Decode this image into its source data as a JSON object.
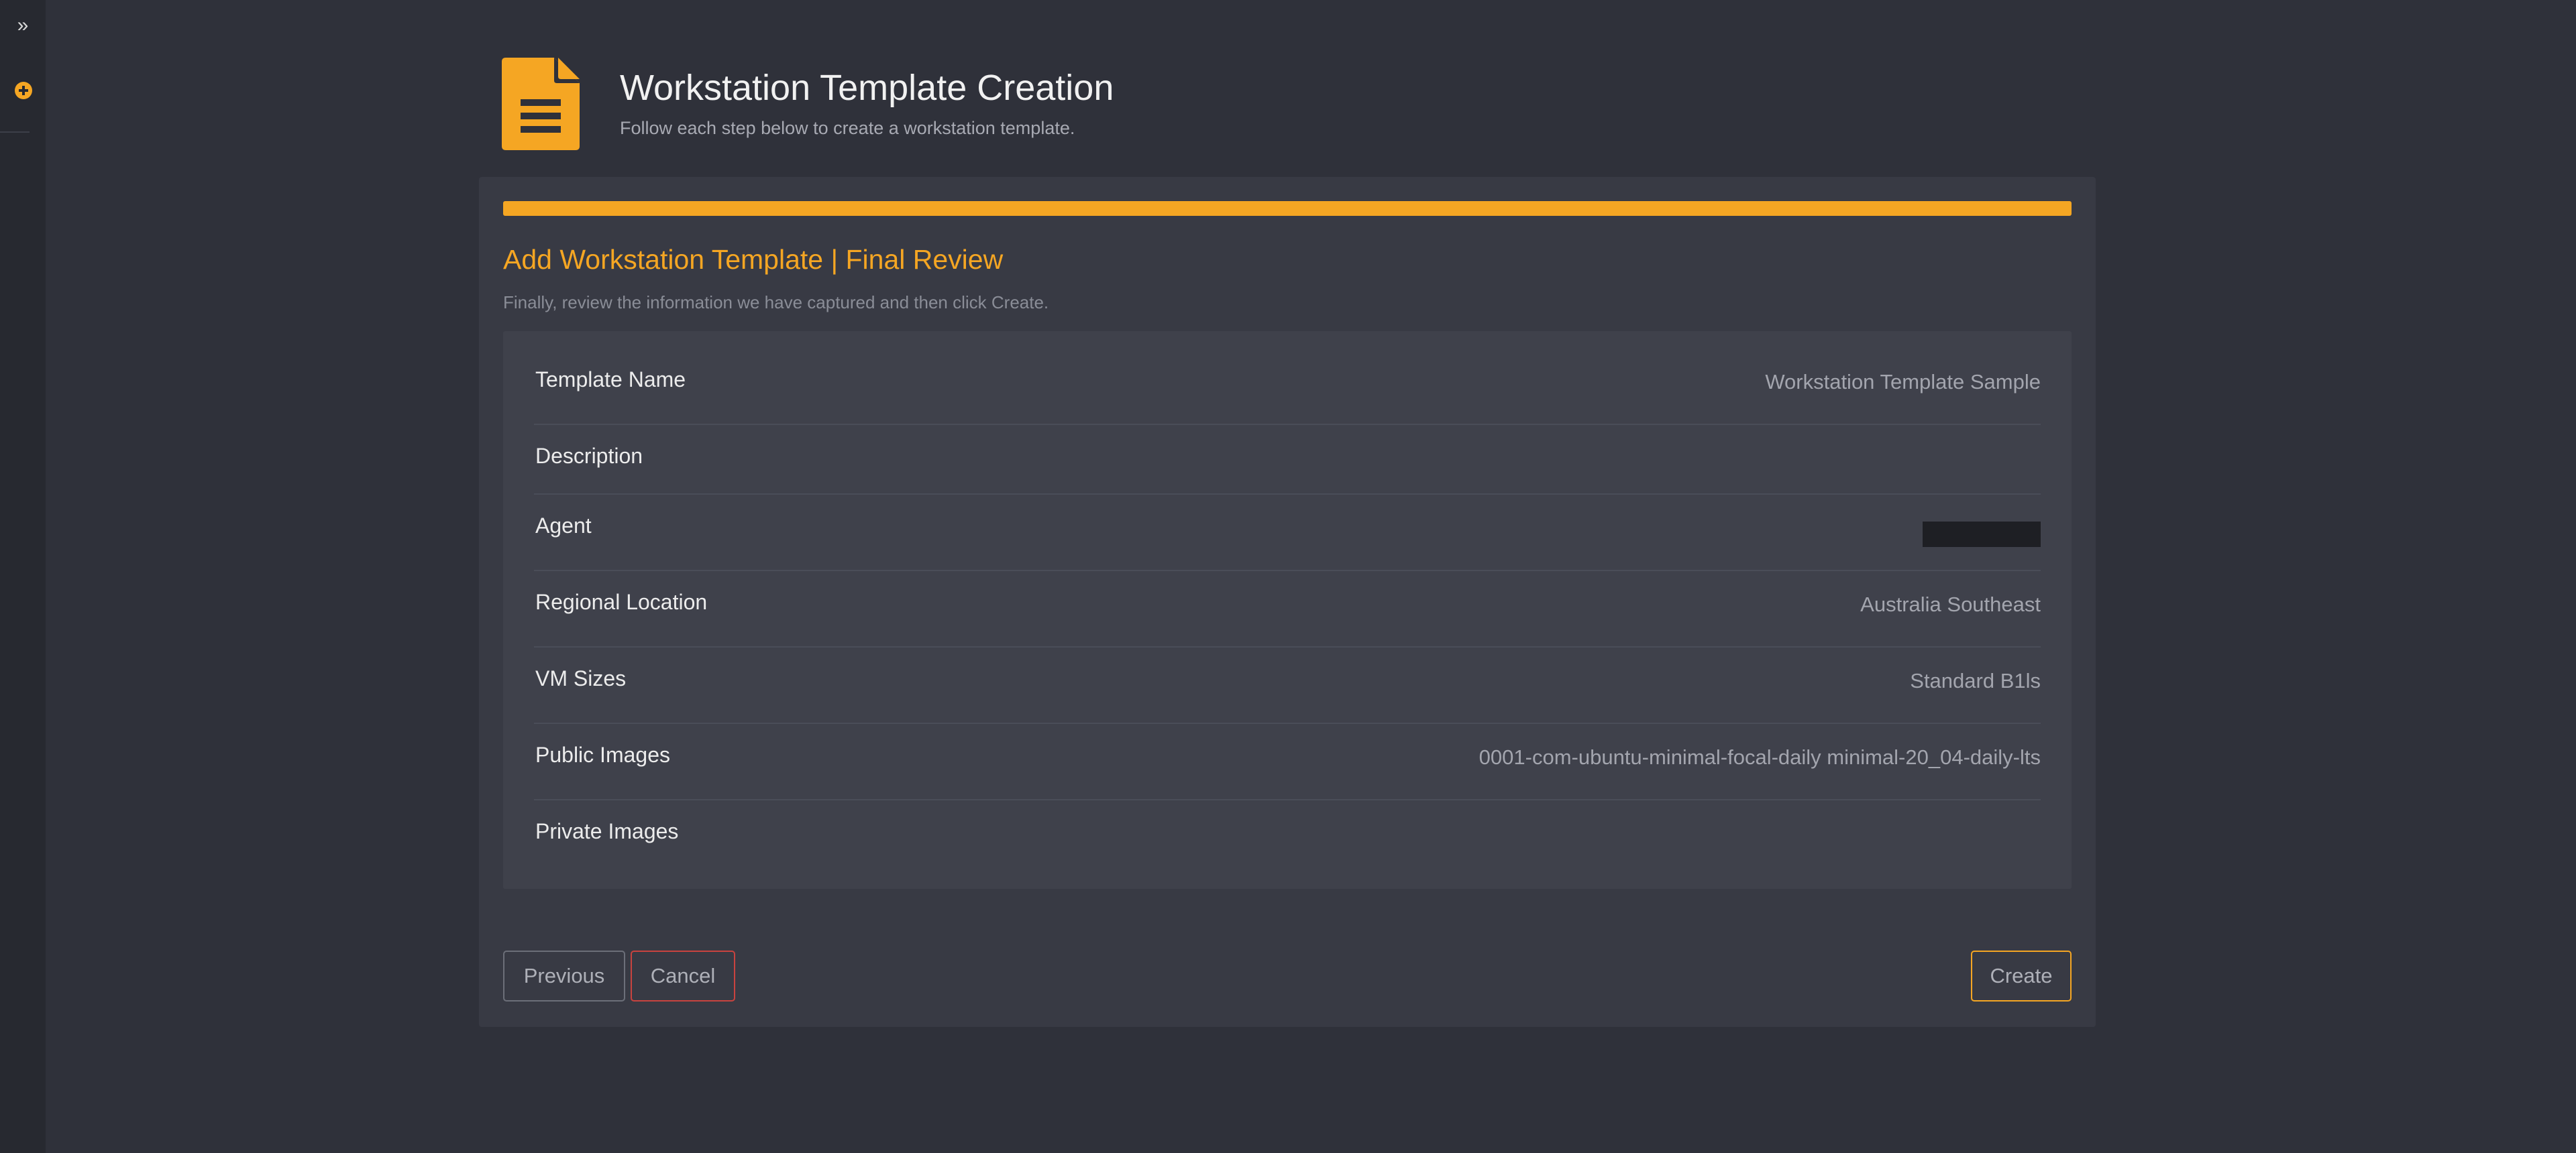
{
  "sidebar": {
    "expand_icon": "double-chevron-right-icon",
    "add_icon": "plus-circle-icon",
    "accent": "#f5a623"
  },
  "header": {
    "icon": "document-icon",
    "title": "Workstation Template Creation",
    "subtitle": "Follow each step below to create a workstation template."
  },
  "step": {
    "progress_percent": 100,
    "title": "Add Workstation Template | Final Review",
    "description": "Finally, review the information we have captured and then click Create."
  },
  "review": {
    "rows": [
      {
        "label": "Template Name",
        "value": "Workstation Template Sample"
      },
      {
        "label": "Description",
        "value": ""
      },
      {
        "label": "Agent",
        "value": ""
      },
      {
        "label": "Regional Location",
        "value": "Australia Southeast"
      },
      {
        "label": "VM Sizes",
        "value": "Standard B1ls"
      },
      {
        "label": "Public Images",
        "value": "0001-com-ubuntu-minimal-focal-daily minimal-20_04-daily-lts"
      },
      {
        "label": "Private Images",
        "value": ""
      }
    ]
  },
  "buttons": {
    "previous": "Previous",
    "cancel": "Cancel",
    "create": "Create"
  },
  "colors": {
    "background": "#2f313a",
    "panel": "#383a44",
    "accent": "#f5a623",
    "danger": "#c9433f"
  }
}
